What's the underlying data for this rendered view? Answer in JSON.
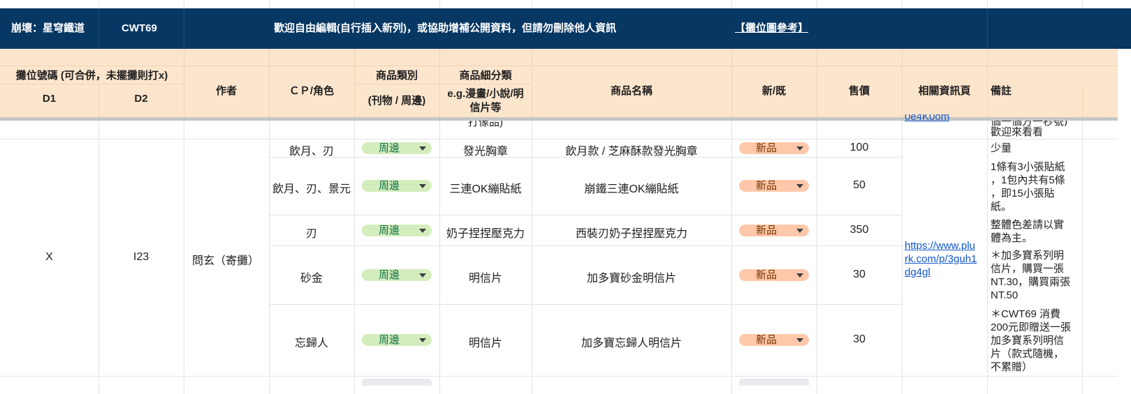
{
  "banner": {
    "game": "崩壞：星穹鐵道",
    "event": "CWT69",
    "notice": "歡迎自由編輯(自行插入新列)，或協助增補公開資料，但請勿刪除他人資訊",
    "map_link": "【攤位圖參考】"
  },
  "headers": {
    "booth_number": "攤位號碼 (可合併，未擺攤則打x)",
    "d1": "D1",
    "d2": "D2",
    "author": "作者",
    "cp": "ＣＰ/角色",
    "category": "商品類別",
    "category_sub": "(刊物 / 周邊)",
    "subcategory": "商品細分類",
    "subcategory_hint_1": "e.g.漫畫/小說/明",
    "subcategory_hint_2": "信片等",
    "product_name": "商品名稱",
    "new_old": "新/既",
    "price": "售價",
    "info_page": "相關資訊頁",
    "remarks": "備註"
  },
  "peek_row": {
    "sub_fragment": "打像品)",
    "link_fragment": "0e4K0om",
    "remark_fragment_1": "個一個方一秒號)",
    "remark_fragment_2": "歡迎來看看"
  },
  "booth": {
    "d1": "X",
    "d2": "I23",
    "author": "問玄（寄攤）",
    "info_link_lines": [
      "https://www.plu",
      "rk.com/p/3guh1",
      "dg4gl"
    ]
  },
  "items": [
    {
      "cp": "飲月、刃",
      "category": "周邊",
      "subcategory": "發光胸章",
      "name": "飲月款 / 芝麻酥款發光胸章",
      "status": "新品",
      "price": "100"
    },
    {
      "cp": "飲月、刃、景元",
      "category": "周邊",
      "subcategory": "三連OK繃貼紙",
      "name": "崩鐵三連OK繃貼紙",
      "status": "新品",
      "price": "50"
    },
    {
      "cp": "刃",
      "category": "周邊",
      "subcategory": "奶子捏捏壓克力",
      "name": "西裝刃奶子捏捏壓克力",
      "status": "新品",
      "price": "350"
    },
    {
      "cp": "砂金",
      "category": "周邊",
      "subcategory": "明信片",
      "name": "加多寶砂金明信片",
      "status": "新品",
      "price": "30"
    },
    {
      "cp": "忘歸人",
      "category": "周邊",
      "subcategory": "明信片",
      "name": "加多寶忘歸人明信片",
      "status": "新品",
      "price": "30"
    }
  ],
  "remarks": [
    [
      "少量"
    ],
    [
      "1條有3小張貼紙",
      "，1包內共有5條",
      "，即15小張貼",
      "紙。"
    ],
    [
      "整體色差請以實",
      "體為主。"
    ],
    [
      "＊加多寶系列明",
      "信片，購買一張",
      "NT.30，購買兩張",
      "NT.50"
    ],
    [
      "＊CWT69 消費",
      "200元即贈送一張",
      "加多寶系列明信",
      "片（款式隨機，",
      "不累贈）"
    ]
  ]
}
